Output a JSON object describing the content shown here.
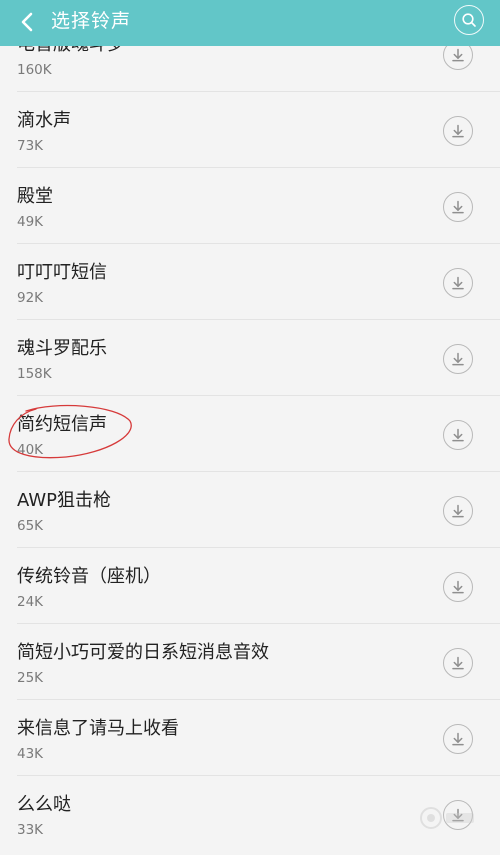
{
  "header": {
    "title": "选择铃声",
    "back_icon": "chevron-left-icon",
    "search_icon": "search-icon",
    "bg_color": "#62c6c8"
  },
  "ringtones": [
    {
      "name": "电音版魂斗罗",
      "size": "160K"
    },
    {
      "name": "滴水声",
      "size": "73K"
    },
    {
      "name": "殿堂",
      "size": "49K"
    },
    {
      "name": "叮叮叮短信",
      "size": "92K"
    },
    {
      "name": "魂斗罗配乐",
      "size": "158K"
    },
    {
      "name": "简约短信声",
      "size": "40K",
      "annotated": true
    },
    {
      "name": "AWP狙击枪",
      "size": "65K"
    },
    {
      "name": "传统铃音（座机）",
      "size": "24K"
    },
    {
      "name": "简短小巧可爱的日系短消息音效",
      "size": "25K"
    },
    {
      "name": "来信息了请马上收看",
      "size": "43K"
    },
    {
      "name": "么么哒",
      "size": "33K"
    }
  ],
  "download_icon": "download-icon",
  "annotation_color": "#d63a3a"
}
